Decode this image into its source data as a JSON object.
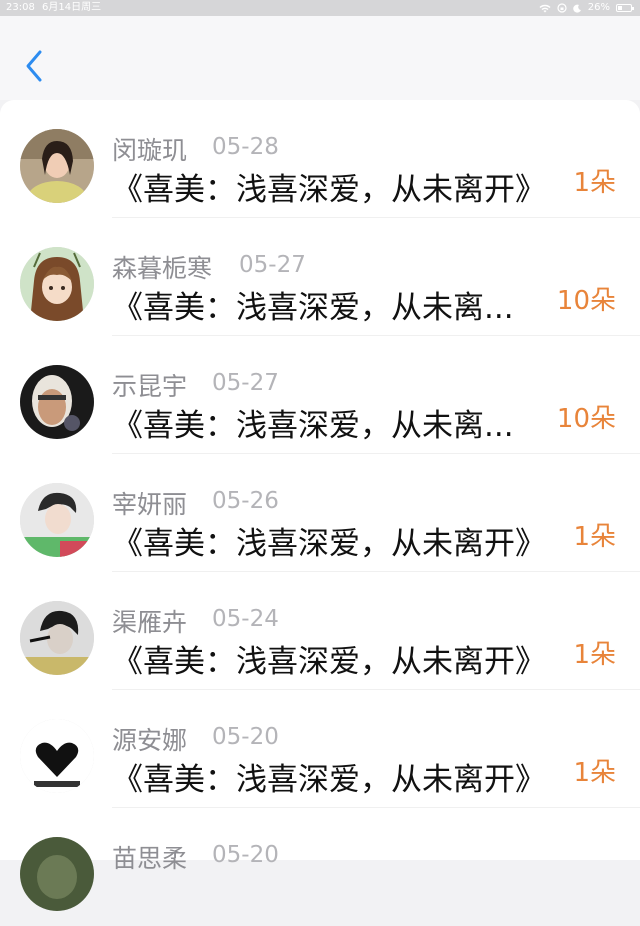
{
  "status_bar": {
    "time": "23:08",
    "date": "6月14日周三",
    "battery": "26%"
  },
  "colors": {
    "accent": "#2d8cf0",
    "count": "#e8843a",
    "name": "#8e8e93"
  },
  "nav": {
    "back_icon": "chevron-left-icon"
  },
  "items": [
    {
      "name": "闵璇玑",
      "date": "05-28",
      "title": "《喜美：浅喜深爱，从未离开》",
      "count": "1朵"
    },
    {
      "name": "森暮栀寒",
      "date": "05-27",
      "title": "《喜美：浅喜深爱，从未离...",
      "count": "10朵"
    },
    {
      "name": "示昆宇",
      "date": "05-27",
      "title": "《喜美：浅喜深爱，从未离...",
      "count": "10朵"
    },
    {
      "name": "宰妍丽",
      "date": "05-26",
      "title": "《喜美：浅喜深爱，从未离开》",
      "count": "1朵"
    },
    {
      "name": "渠雁卉",
      "date": "05-24",
      "title": "《喜美：浅喜深爱，从未离开》",
      "count": "1朵"
    },
    {
      "name": "源安娜",
      "date": "05-20",
      "title": "《喜美：浅喜深爱，从未离开》",
      "count": "1朵"
    },
    {
      "name": "苗思柔",
      "date": "05-20",
      "title": "",
      "count": ""
    }
  ]
}
